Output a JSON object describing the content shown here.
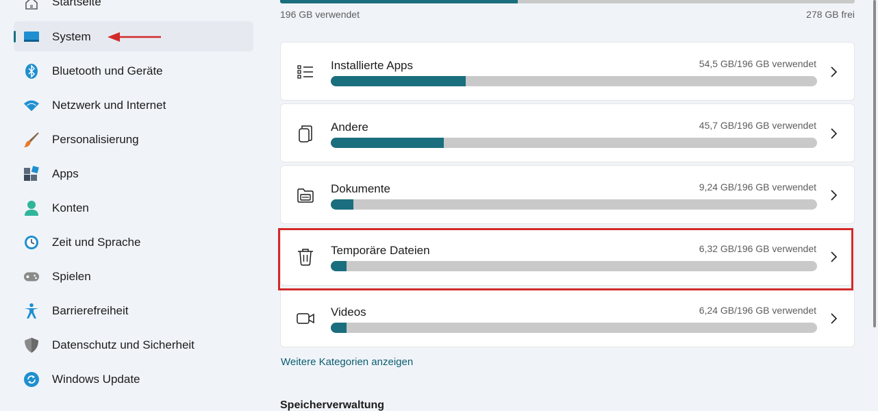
{
  "sidebar": {
    "items": [
      {
        "label": "Startseite",
        "icon": "home-icon",
        "selected": false
      },
      {
        "label": "System",
        "icon": "system-icon",
        "selected": true
      },
      {
        "label": "Bluetooth und Geräte",
        "icon": "bluetooth-icon",
        "selected": false
      },
      {
        "label": "Netzwerk und Internet",
        "icon": "wifi-icon",
        "selected": false
      },
      {
        "label": "Personalisierung",
        "icon": "brush-icon",
        "selected": false
      },
      {
        "label": "Apps",
        "icon": "apps-icon",
        "selected": false
      },
      {
        "label": "Konten",
        "icon": "account-icon",
        "selected": false
      },
      {
        "label": "Zeit und Sprache",
        "icon": "time-language-icon",
        "selected": false
      },
      {
        "label": "Spielen",
        "icon": "gamepad-icon",
        "selected": false
      },
      {
        "label": "Barrierefreiheit",
        "icon": "accessibility-icon",
        "selected": false
      },
      {
        "label": "Datenschutz und Sicherheit",
        "icon": "shield-icon",
        "selected": false
      },
      {
        "label": "Windows Update",
        "icon": "update-icon",
        "selected": false
      }
    ]
  },
  "storage": {
    "used_label": "196 GB verwendet",
    "free_label": "278 GB frei",
    "used_fraction": 0.413
  },
  "categories": [
    {
      "title": "Installierte Apps",
      "usage": "54,5 GB/196 GB verwendet",
      "fraction": 0.278,
      "icon": "list-icon"
    },
    {
      "title": "Andere",
      "usage": "45,7 GB/196 GB verwendet",
      "fraction": 0.233,
      "icon": "file-copy-icon"
    },
    {
      "title": "Dokumente",
      "usage": "9,24 GB/196 GB verwendet",
      "fraction": 0.047,
      "icon": "folder-icon"
    },
    {
      "title": "Temporäre Dateien",
      "usage": "6,32 GB/196 GB verwendet",
      "fraction": 0.032,
      "icon": "trash-icon"
    },
    {
      "title": "Videos",
      "usage": "6,24 GB/196 GB verwendet",
      "fraction": 0.032,
      "icon": "video-icon"
    }
  ],
  "more_link": "Weitere Kategorien anzeigen",
  "section_title": "Speicherverwaltung",
  "colors": {
    "accent": "#1a6e7d",
    "bar_track": "#c9c9c9",
    "annotation_red": "#d22a2a",
    "background": "#f0f4f9"
  }
}
